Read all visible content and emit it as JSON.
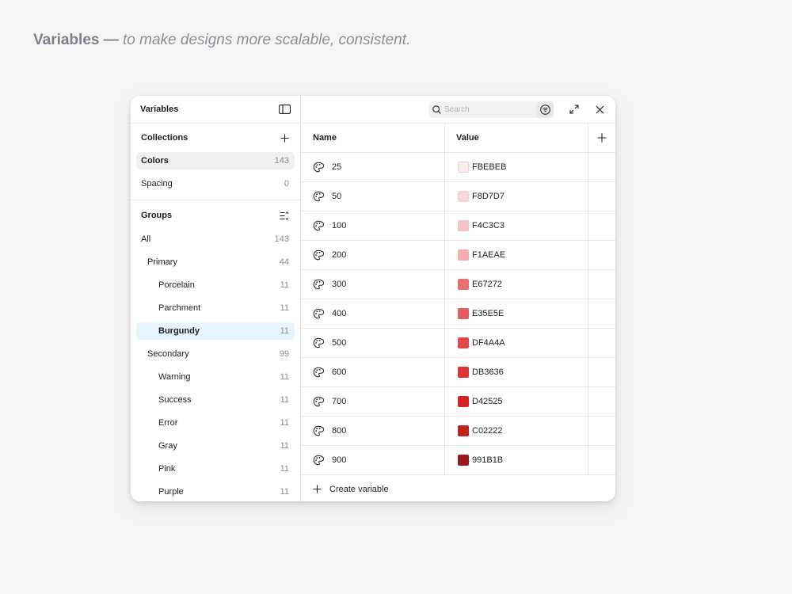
{
  "headline": {
    "bold": "Variables —",
    "italic": "to make designs more scalable, consistent."
  },
  "sidebar": {
    "title": "Variables",
    "collections_title": "Collections",
    "collections": [
      {
        "label": "Colors",
        "count": "143"
      },
      {
        "label": "Spacing",
        "count": "0"
      }
    ],
    "groups_title": "Groups",
    "groups": [
      {
        "label": "All",
        "count": "143"
      },
      {
        "label": "Primary",
        "count": "44"
      },
      {
        "label": "Porcelain",
        "count": "11"
      },
      {
        "label": "Parchment",
        "count": "11"
      },
      {
        "label": "Burgundy",
        "count": "11"
      },
      {
        "label": "Secondary",
        "count": "99"
      },
      {
        "label": "Warning",
        "count": "11"
      },
      {
        "label": "Success",
        "count": "11"
      },
      {
        "label": "Error",
        "count": "11"
      },
      {
        "label": "Gray",
        "count": "11"
      },
      {
        "label": "Pink",
        "count": "11"
      },
      {
        "label": "Purple",
        "count": "11"
      }
    ]
  },
  "search": {
    "placeholder": "Search"
  },
  "table": {
    "header_name": "Name",
    "header_value": "Value",
    "rows": [
      {
        "name": "25",
        "value": "FBEBEB",
        "color": "#FBEBEB"
      },
      {
        "name": "50",
        "value": "F8D7D7",
        "color": "#F8D7D7"
      },
      {
        "name": "100",
        "value": "F4C3C3",
        "color": "#F4C3C3"
      },
      {
        "name": "200",
        "value": "F1AEAE",
        "color": "#F1AEAE"
      },
      {
        "name": "300",
        "value": "E67272",
        "color": "#E67272"
      },
      {
        "name": "400",
        "value": "E35E5E",
        "color": "#E35E5E"
      },
      {
        "name": "500",
        "value": "DF4A4A",
        "color": "#DF4A4A"
      },
      {
        "name": "600",
        "value": "DB3636",
        "color": "#DB3636"
      },
      {
        "name": "700",
        "value": "D42525",
        "color": "#D42525"
      },
      {
        "name": "800",
        "value": "C02222",
        "color": "#C02222"
      },
      {
        "name": "900",
        "value": "991B1B",
        "color": "#991B1B"
      }
    ],
    "create_label": "Create variable"
  },
  "colors": {
    "selection_blue": "#e5f4ff",
    "selection_gray": "#f0f0f0"
  }
}
